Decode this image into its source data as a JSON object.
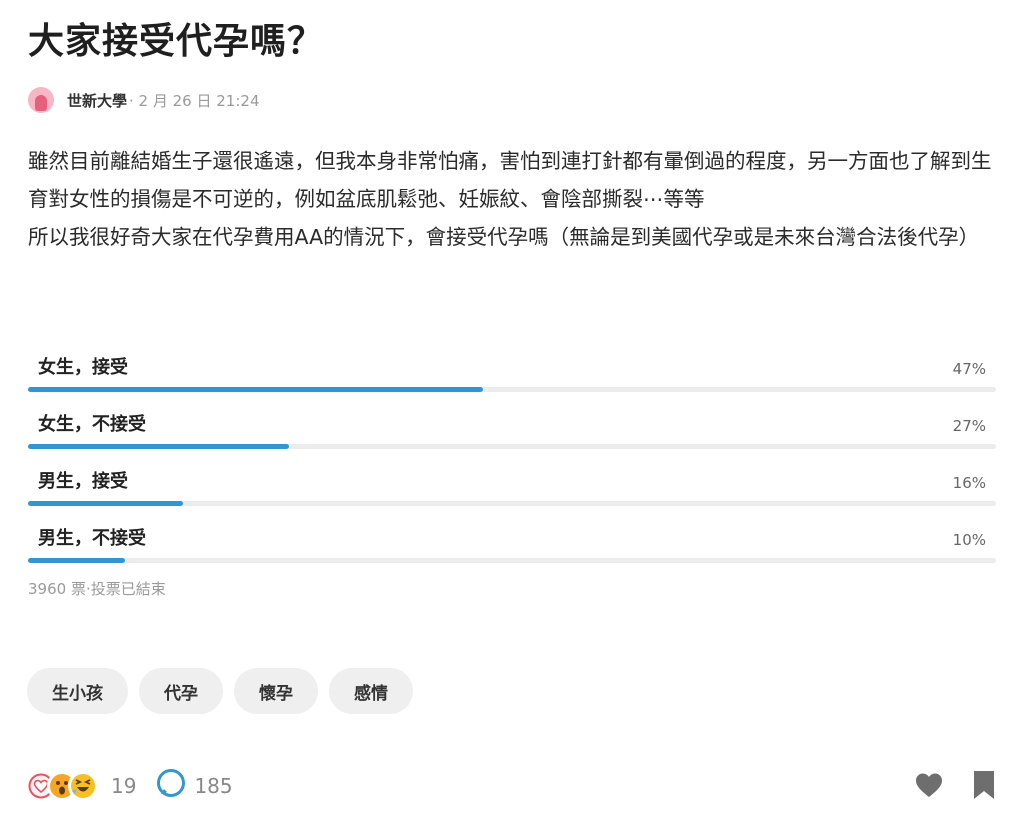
{
  "post": {
    "title": "大家接受代孕嗎？",
    "school": "世新大學",
    "time": "· 2 月 26 日 21:24",
    "body": "雖然目前離結婚生子還很遙遠，但我本身非常怕痛，害怕到連打針都有暈倒過的程度，另一方面也了解到生育對女性的損傷是不可逆的，例如盆底肌鬆弛、妊娠紋、會陰部撕裂⋯等等\n所以我很好奇大家在代孕費用AA的情況下，會接受代孕嗎（無論是到美國代孕或是未來台灣合法後代孕）"
  },
  "poll": {
    "options": [
      {
        "label": "女生，接受",
        "percent_text": "47%",
        "percent": 47
      },
      {
        "label": "女生，不接受",
        "percent_text": "27%",
        "percent": 27
      },
      {
        "label": "男生，接受",
        "percent_text": "16%",
        "percent": 16
      },
      {
        "label": "男生，不接受",
        "percent_text": "10%",
        "percent": 10
      }
    ],
    "status": "3960 票·投票已結束",
    "bar_color": "#3397cf"
  },
  "tags": [
    "生小孩",
    "代孕",
    "懷孕",
    "感情"
  ],
  "footer": {
    "reaction_icons": [
      "heart-reaction-icon",
      "surprised-reaction-icon",
      "laughing-reaction-icon"
    ],
    "like_count": "19",
    "comment_count": "185"
  }
}
